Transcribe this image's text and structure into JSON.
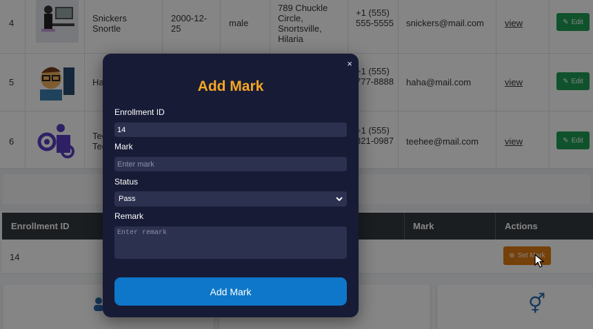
{
  "students": [
    {
      "id": "4",
      "name": "Snickers Snortle",
      "dob": "2000-12-25",
      "gender": "male",
      "address": "789 Chuckle Circle, Snortsville, Hilaria",
      "phone": "+1 (555) 555-5555",
      "email": "snickers@mail.com",
      "view": "view",
      "edit": "Edit"
    },
    {
      "id": "5",
      "name": "Ha",
      "phone": "+1 (555) 777-8888",
      "email": "haha@mail.com",
      "view": "view",
      "edit": "Edit"
    },
    {
      "id": "6",
      "name": "Tee Tee",
      "phone": "+1 (555) 321-0987",
      "email": "teehee@mail.com",
      "view": "view",
      "edit": "Edit"
    }
  ],
  "enrollment_table": {
    "headers": [
      "Enrollment ID",
      "Mark",
      "Actions"
    ],
    "row": {
      "enrollment_id": "14",
      "action": "Set Mark"
    }
  },
  "modal": {
    "title": "Add Mark",
    "close": "×",
    "enrollment_label": "Enrollment ID",
    "enrollment_value": "14",
    "mark_label": "Mark",
    "mark_placeholder": "Enter mark",
    "status_label": "Status",
    "status_value": "Pass",
    "remark_label": "Remark",
    "remark_placeholder": "Enter remark",
    "submit": "Add Mark"
  },
  "colors": {
    "accent": "#f5a623",
    "primary": "#0e77c9",
    "edit": "#1f9d55",
    "setmark": "#e07b12"
  }
}
